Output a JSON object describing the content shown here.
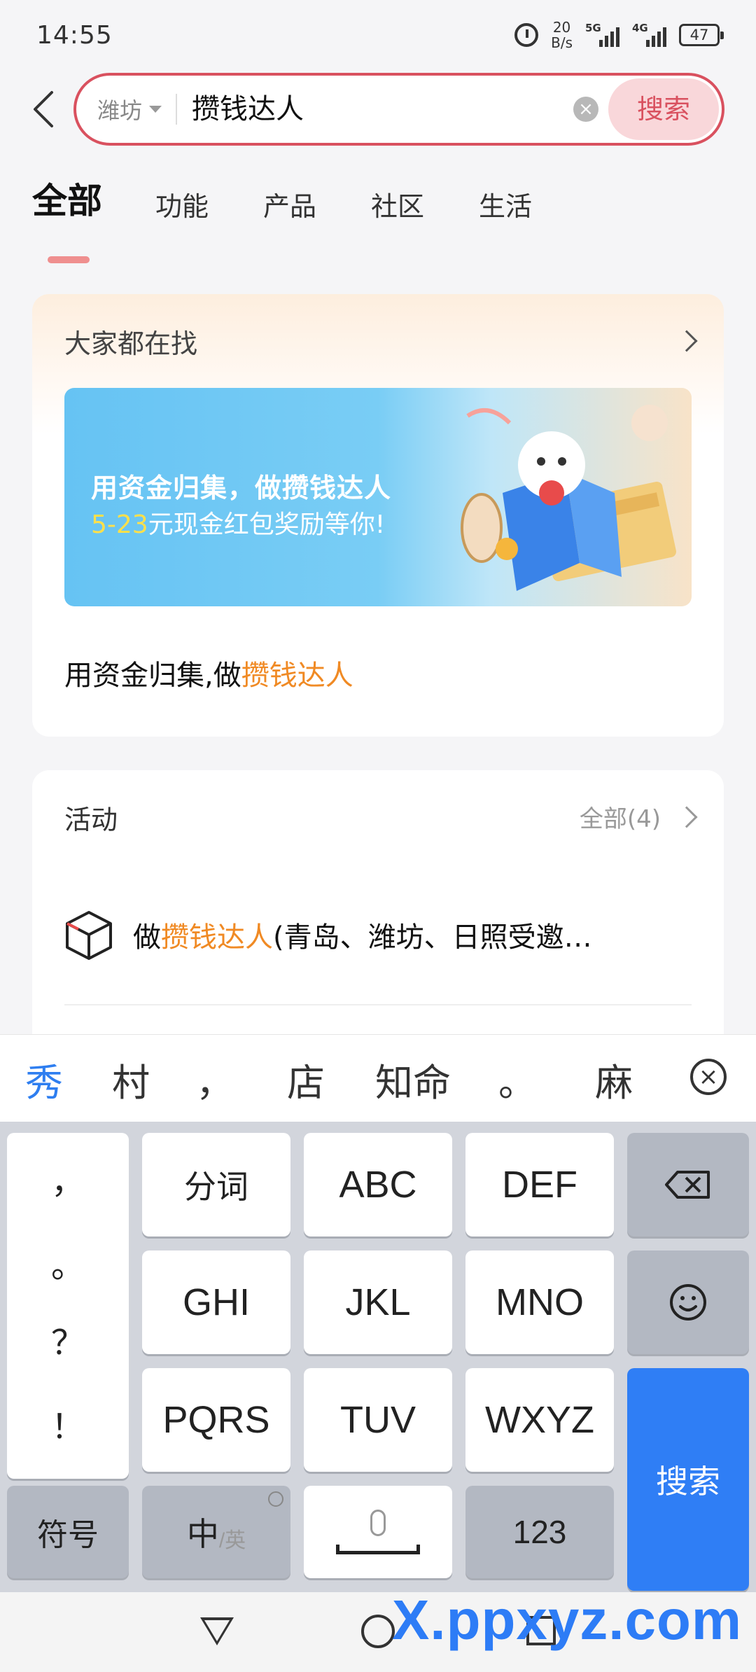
{
  "status_bar": {
    "time": "14:55",
    "net_speed_value": "20",
    "net_speed_unit": "B/s",
    "sim1_label": "5G",
    "sim2_label": "4G",
    "battery": "47"
  },
  "search": {
    "city": "潍坊",
    "query": "攒钱达人",
    "button_label": "搜索"
  },
  "tabs": [
    {
      "label": "全部",
      "active": true
    },
    {
      "label": "功能",
      "active": false
    },
    {
      "label": "产品",
      "active": false
    },
    {
      "label": "社区",
      "active": false
    },
    {
      "label": "生活",
      "active": false
    }
  ],
  "trending": {
    "title": "大家都在找",
    "banner_line1": "用资金归集，做攒钱达人",
    "banner_line2_highlight": "5-23",
    "banner_line2_rest": "元现金红包奖励等你!",
    "subtitle_prefix": "用资金归集,做",
    "subtitle_highlight": "攒钱达人"
  },
  "activity": {
    "title": "活动",
    "all_label": "全部(4)",
    "item_prefix": "做",
    "item_highlight": "攒钱达人",
    "item_rest": "(青岛、潍坊、日照受邀…"
  },
  "candidates": [
    "秀",
    "村",
    "，",
    "店",
    "知命",
    "。",
    "麻"
  ],
  "keyboard": {
    "punct": [
      "，",
      "。",
      "？",
      "！"
    ],
    "row1": [
      "分词",
      "ABC",
      "DEF"
    ],
    "row2": [
      "GHI",
      "JKL",
      "MNO"
    ],
    "row3": [
      "PQRS",
      "TUV",
      "WXYZ"
    ],
    "symbols": "符号",
    "lang_main": "中",
    "lang_sub": "/英",
    "numbers": "123",
    "enter": "搜索"
  },
  "watermark": {
    "main": "X.ppxyz.com",
    "sub": "x.ppxyz.com"
  },
  "colors": {
    "accent": "#d9515f",
    "highlight": "#f08a24",
    "keyboard_blue": "#2f7ef5"
  }
}
